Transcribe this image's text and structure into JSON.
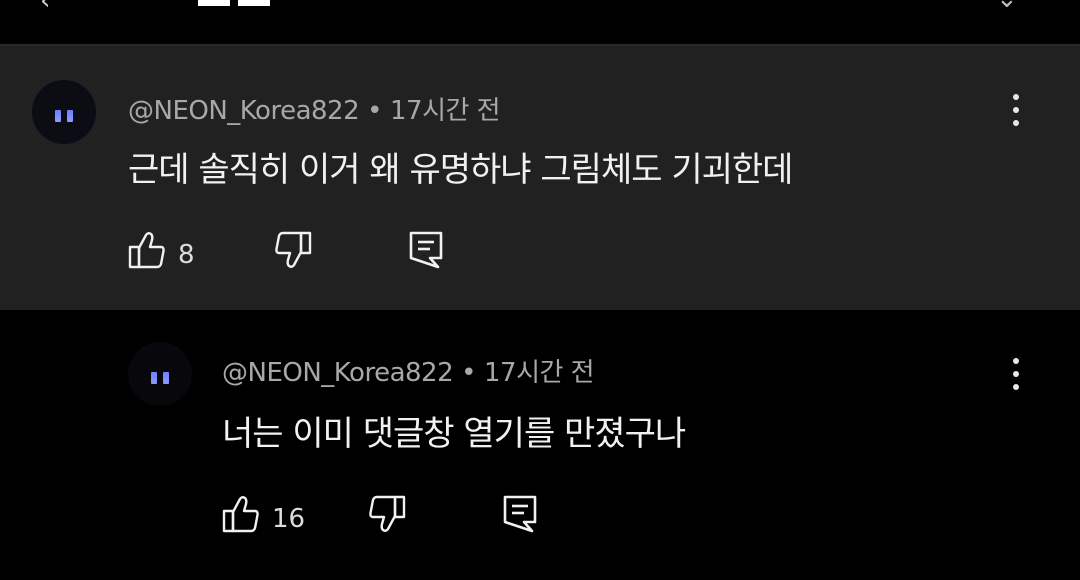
{
  "comments": [
    {
      "author": "@NEON_Korea822",
      "separator": "•",
      "time": "17시간 전",
      "text": "근데 솔직히 이거 왜 유명하냐 그림체도 기괴한데",
      "likes": "8",
      "icons": {
        "like": "thumbs-up-icon",
        "dislike": "thumbs-down-icon",
        "reply": "reply-icon",
        "more": "more-vertical-icon"
      }
    },
    {
      "author": "@NEON_Korea822",
      "separator": "•",
      "time": "17시간 전",
      "text": "너는 이미 댓글창 열기를 만졌구나",
      "likes": "16",
      "icons": {
        "like": "thumbs-up-icon",
        "dislike": "thumbs-down-icon",
        "reply": "reply-icon",
        "more": "more-vertical-icon"
      }
    }
  ],
  "colors": {
    "background": "#000000",
    "highlight_background": "#212121",
    "meta_text": "#a8a8a8",
    "body_text": "#f1f1f1",
    "avatar_eyes": "#7c8cff"
  }
}
